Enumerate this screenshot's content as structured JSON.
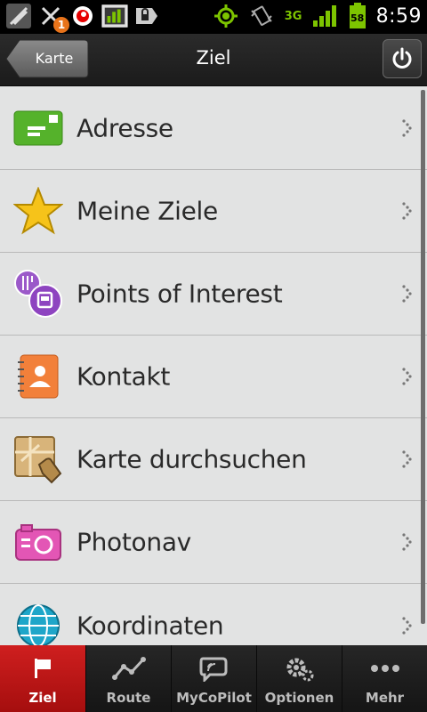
{
  "status_bar": {
    "notification_count": "1",
    "network": "3G",
    "battery": "58",
    "time": "8:59"
  },
  "header": {
    "back_label": "Karte",
    "title": "Ziel"
  },
  "list": {
    "items": [
      {
        "label": "Adresse",
        "icon": "address-card-icon"
      },
      {
        "label": "Meine Ziele",
        "icon": "star-icon"
      },
      {
        "label": "Points of Interest",
        "icon": "poi-icon"
      },
      {
        "label": "Kontakt",
        "icon": "contact-icon"
      },
      {
        "label": "Karte durchsuchen",
        "icon": "map-browse-icon"
      },
      {
        "label": "Photonav",
        "icon": "camera-icon"
      },
      {
        "label": "Koordinaten",
        "icon": "globe-icon"
      }
    ]
  },
  "tabs": [
    {
      "label": "Ziel",
      "icon": "flag-icon",
      "active": true
    },
    {
      "label": "Route",
      "icon": "route-icon",
      "active": false
    },
    {
      "label": "MyCoPilot",
      "icon": "mycopilot-icon",
      "active": false
    },
    {
      "label": "Optionen",
      "icon": "gears-icon",
      "active": false
    },
    {
      "label": "Mehr",
      "icon": "more-icon",
      "active": false
    }
  ],
  "colors": {
    "accent_red": "#c01717",
    "list_bg": "#e2e3e3",
    "green": "#7dc400"
  }
}
